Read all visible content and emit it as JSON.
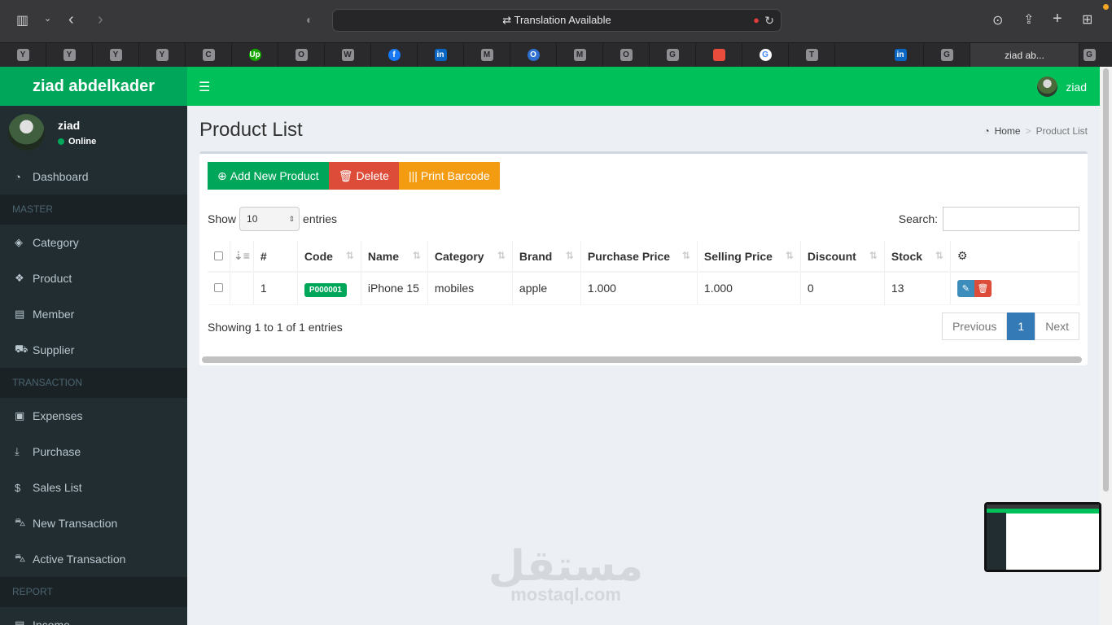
{
  "browser": {
    "address_text": "Translation Available",
    "bookmarks": [
      "Y",
      "Y",
      "Y",
      "Y",
      "C",
      "Up",
      "O",
      "W",
      "f",
      "in",
      "M",
      "O",
      "M",
      "O",
      "G",
      "",
      "G",
      "T",
      "in",
      "G"
    ],
    "active_tab": "ziad ab...",
    "last_tab": "G"
  },
  "app": {
    "logo": "ziad abdelkader",
    "nav_user": "ziad"
  },
  "sidebar": {
    "user_name": "ziad",
    "user_status": "Online",
    "dashboard": "Dashboard",
    "header_master": "MASTER",
    "category": "Category",
    "product": "Product",
    "member": "Member",
    "supplier": "Supplier",
    "header_transaction": "TRANSACTION",
    "expenses": "Expenses",
    "purchase": "Purchase",
    "sales_list": "Sales List",
    "new_transaction": "New Transaction",
    "active_transaction": "Active Transaction",
    "header_report": "REPORT",
    "income": "Income"
  },
  "page": {
    "title": "Product List",
    "breadcrumb_home": "Home",
    "breadcrumb_current": "Product List"
  },
  "toolbar": {
    "add": "Add New Product",
    "delete": "Delete",
    "barcode": "Print Barcode"
  },
  "table_controls": {
    "show": "Show",
    "page_size": "10",
    "entries": "entries",
    "search_label": "Search:",
    "showing": "Showing 1 to 1 of 1 entries",
    "prev": "Previous",
    "page": "1",
    "next": "Next"
  },
  "table": {
    "headers": [
      "#",
      "Code",
      "Name",
      "Category",
      "Brand",
      "Purchase Price",
      "Selling Price",
      "Discount",
      "Stock"
    ],
    "rows": [
      {
        "no": "1",
        "code": "P000001",
        "name": "iPhone 15",
        "category": "mobiles",
        "brand": "apple",
        "purchase": "1.000",
        "selling": "1.000",
        "discount": "0",
        "stock": "13"
      }
    ]
  },
  "watermark": {
    "arabic": "مستقل",
    "latin": "mostaql.com"
  }
}
